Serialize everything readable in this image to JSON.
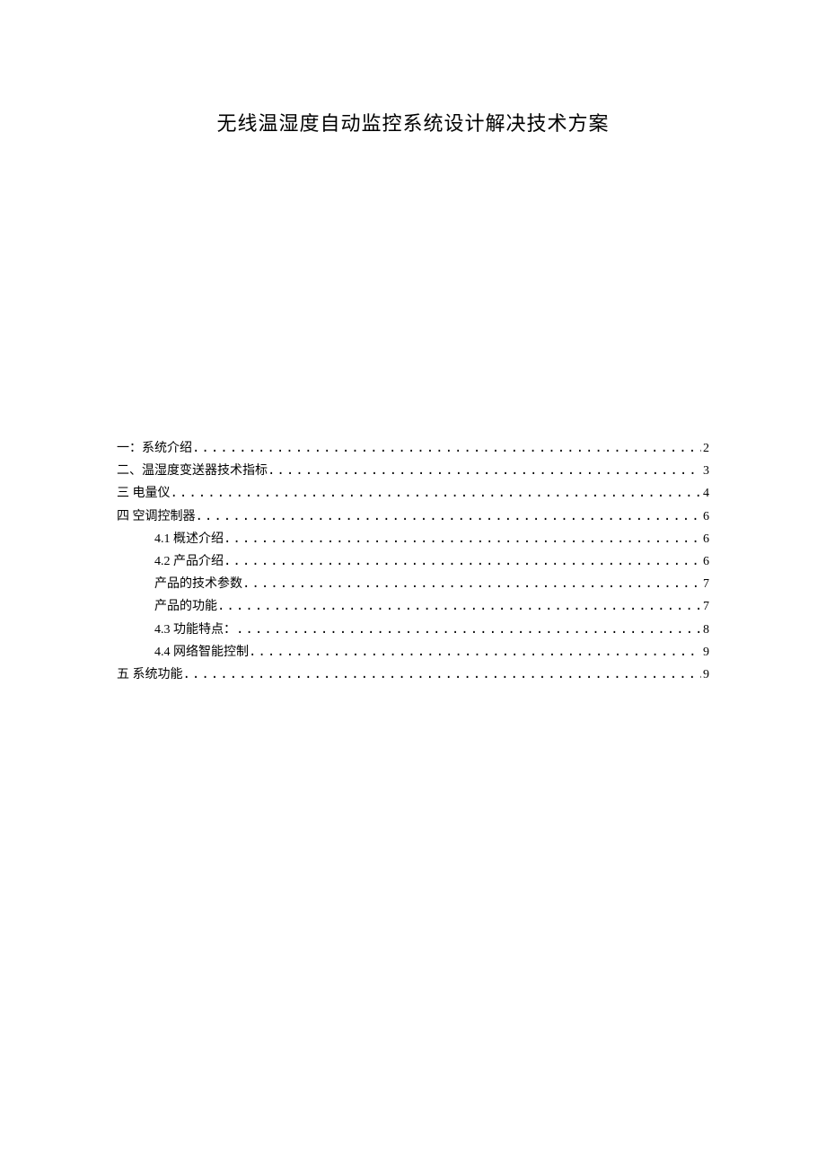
{
  "title": "无线温湿度自动监控系统设计解决技术方案",
  "toc": [
    {
      "level": 1,
      "label": "一：系统介绍",
      "page": "2"
    },
    {
      "level": 1,
      "label": "二、温湿度变送器技术指标",
      "page": "3"
    },
    {
      "level": 1,
      "label": "三 电量仪",
      "page": "4"
    },
    {
      "level": 1,
      "label": "四 空调控制器",
      "page": "6"
    },
    {
      "level": 2,
      "label": "4.1 概述介绍",
      "page": "6"
    },
    {
      "level": 2,
      "label": "4.2 产品介绍",
      "page": "6"
    },
    {
      "level": 2,
      "label": "产品的技术参数",
      "page": "7"
    },
    {
      "level": 2,
      "label": "产品的功能",
      "page": "7"
    },
    {
      "level": 2,
      "label": "4.3 功能特点：",
      "page": "8"
    },
    {
      "level": 2,
      "label": "4.4 网络智能控制",
      "page": "9"
    },
    {
      "level": 1,
      "label": " 五 系统功能",
      "page": "9"
    }
  ]
}
